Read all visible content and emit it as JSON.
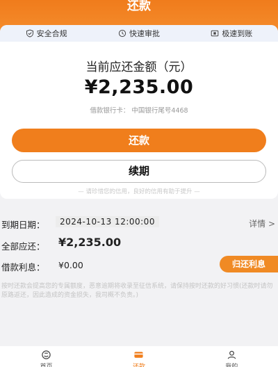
{
  "header": {
    "title": "还款"
  },
  "badges": [
    {
      "label": "安全合规",
      "icon": "shield-check-icon"
    },
    {
      "label": "快速审批",
      "icon": "clock-icon"
    },
    {
      "label": "极速到账",
      "icon": "card-icon"
    }
  ],
  "summary": {
    "title": "当前应还金额（元）",
    "amount": "¥2,235.00",
    "bank": "借款银行卡：  中国银行尾号4468"
  },
  "actions": {
    "repay": "还款",
    "renew": "续期",
    "tip": "— 请珍惜您的信用，良好的信用有助于提升 —"
  },
  "details": {
    "due_label": "到期日期：",
    "due_value": "2024-10-13 12:00:00",
    "detail_link": "详情 >",
    "total_label": "全部应还：",
    "total_value": "¥2,235.00",
    "interest_label": "借款利息：",
    "interest_value": "¥0.00",
    "interest_button": "归还利息"
  },
  "notice": "按时还款会提高您的专属额度，恶意逾期将收录至征信系统，请保持按时还款的好习惯(还款时请勿原路返还，因此造成的资金损失，我司概不负责。)",
  "tabbar": [
    {
      "label": "首页",
      "icon": "home-icon",
      "active": false
    },
    {
      "label": "还款",
      "icon": "wallet-icon",
      "active": true
    },
    {
      "label": "我的",
      "icon": "user-icon",
      "active": false
    }
  ],
  "colors": {
    "accent": "#f07e1c",
    "badge_bg": "#eef2fa"
  }
}
